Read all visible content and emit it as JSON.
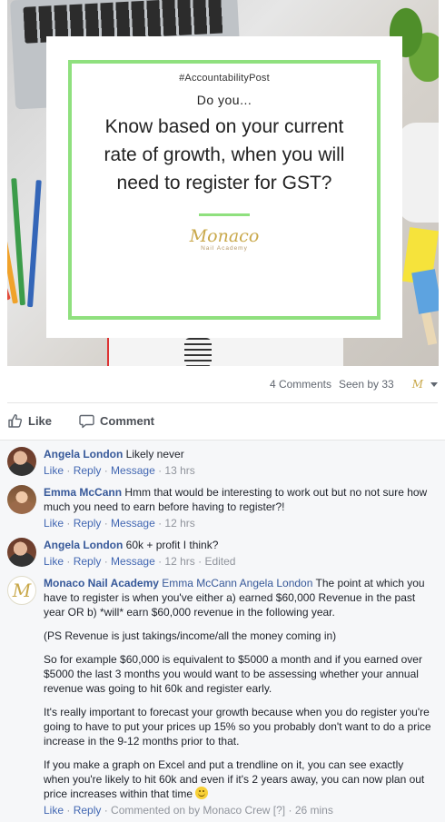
{
  "post": {
    "hashtag": "#AccountabilityPost",
    "intro": "Do you...",
    "headline": "Know based on your current rate of growth, when you will need to register for GST?",
    "logo_word": "Monaco",
    "logo_sub": "Nail Academy"
  },
  "stats": {
    "comments": "4 Comments",
    "seen_by": "Seen by 33",
    "page_logo": "M"
  },
  "actions": {
    "like": "Like",
    "comment": "Comment"
  },
  "comments": [
    {
      "name": "Angela London",
      "text": "Likely never",
      "like": "Like",
      "reply": "Reply",
      "message": "Message",
      "time": "13 hrs"
    },
    {
      "name": "Emma McCann",
      "text": "Hmm that would be interesting to work out but no not sure how much you need to earn before having to register?!",
      "like": "Like",
      "reply": "Reply",
      "message": "Message",
      "time": "12 hrs"
    },
    {
      "name": "Angela London",
      "text": "60k + profit I think?",
      "like": "Like",
      "reply": "Reply",
      "message": "Message",
      "time": "12 hrs",
      "edited": "Edited"
    },
    {
      "name": "Monaco Nail Academy",
      "tag1": "Emma McCann",
      "tag2": "Angela London",
      "avatar_letter": "M",
      "p1": "The point at which you have to register is when you've either a) earned $60,000 Revenue in the past year OR b) *will* earn $60,000 revenue in the following year.",
      "p2": "(PS Revenue is just takings/income/all the money coming in)",
      "p3": "So for example $60,000 is equivalent to $5000 a month and if you earned over $5000 the last 3 months you would want to be assessing whether your annual revenue was going to hit 60k and register early.",
      "p4": "It's really important to forecast your growth because when you do register you're going to have to put your prices up 15% so you probably don't want to do a price increase in the 9-12 months prior to that.",
      "p5": "If you make a graph on Excel and put a trendline on it, you can see exactly when you're likely to hit 60k and even if it's 2 years away, you can now plan out price increases within that time",
      "like": "Like",
      "reply": "Reply",
      "commented_on": "Commented on by Monaco Crew [?]",
      "time": "26 mins"
    }
  ]
}
